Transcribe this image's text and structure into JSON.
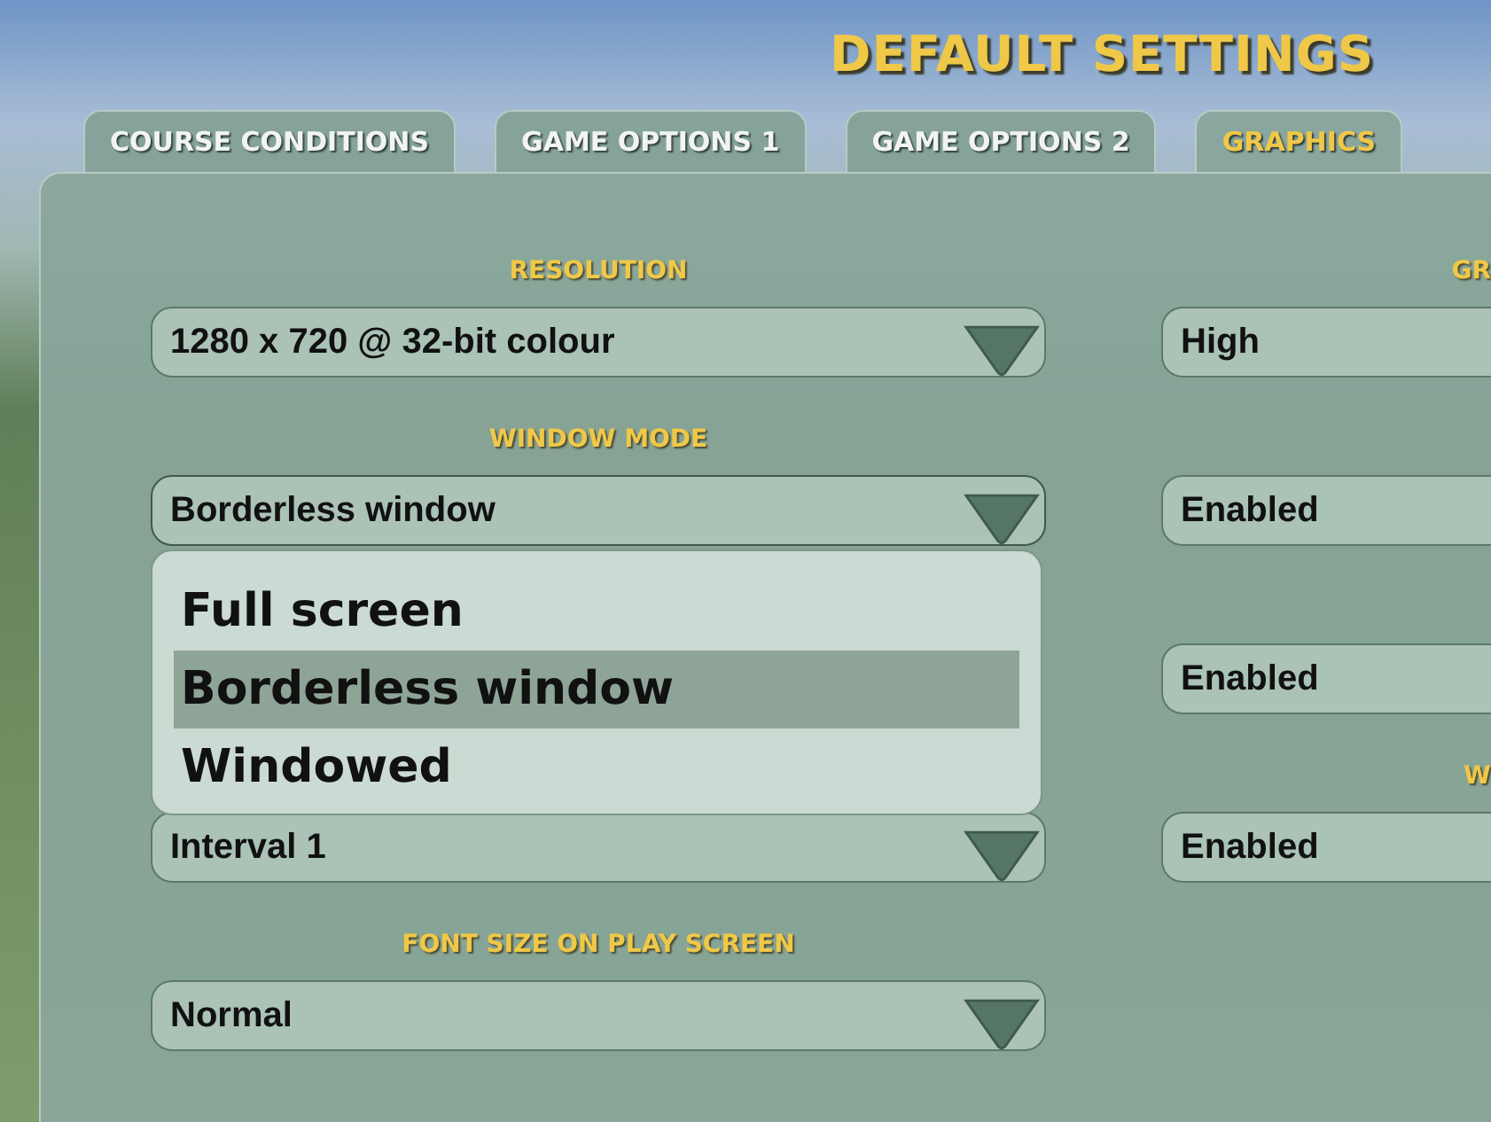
{
  "title": "DEFAULT SETTINGS",
  "tabs": [
    {
      "label": "COURSE CONDITIONS",
      "selected": false
    },
    {
      "label": "GAME OPTIONS 1",
      "selected": false
    },
    {
      "label": "GAME OPTIONS 2",
      "selected": false
    },
    {
      "label": "GRAPHICS",
      "selected": true
    }
  ],
  "left_column": [
    {
      "label": "RESOLUTION",
      "value": "1280 x 720 @ 32-bit colour",
      "expanded": false
    },
    {
      "label": "WINDOW MODE",
      "value": "Borderless window",
      "expanded": true,
      "options": [
        {
          "label": "Full screen",
          "selected": false
        },
        {
          "label": "Borderless window",
          "selected": true
        },
        {
          "label": "Windowed",
          "selected": false
        }
      ]
    },
    {
      "value": "Interval 1",
      "expanded": false
    },
    {
      "label": "FONT SIZE ON PLAY SCREEN",
      "value": "Normal",
      "expanded": false
    }
  ],
  "right_column": [
    {
      "label": "GR",
      "value": "High"
    },
    {
      "value": "Enabled"
    },
    {
      "value": "Enabled"
    },
    {
      "label": "W",
      "value": "Enabled"
    }
  ]
}
